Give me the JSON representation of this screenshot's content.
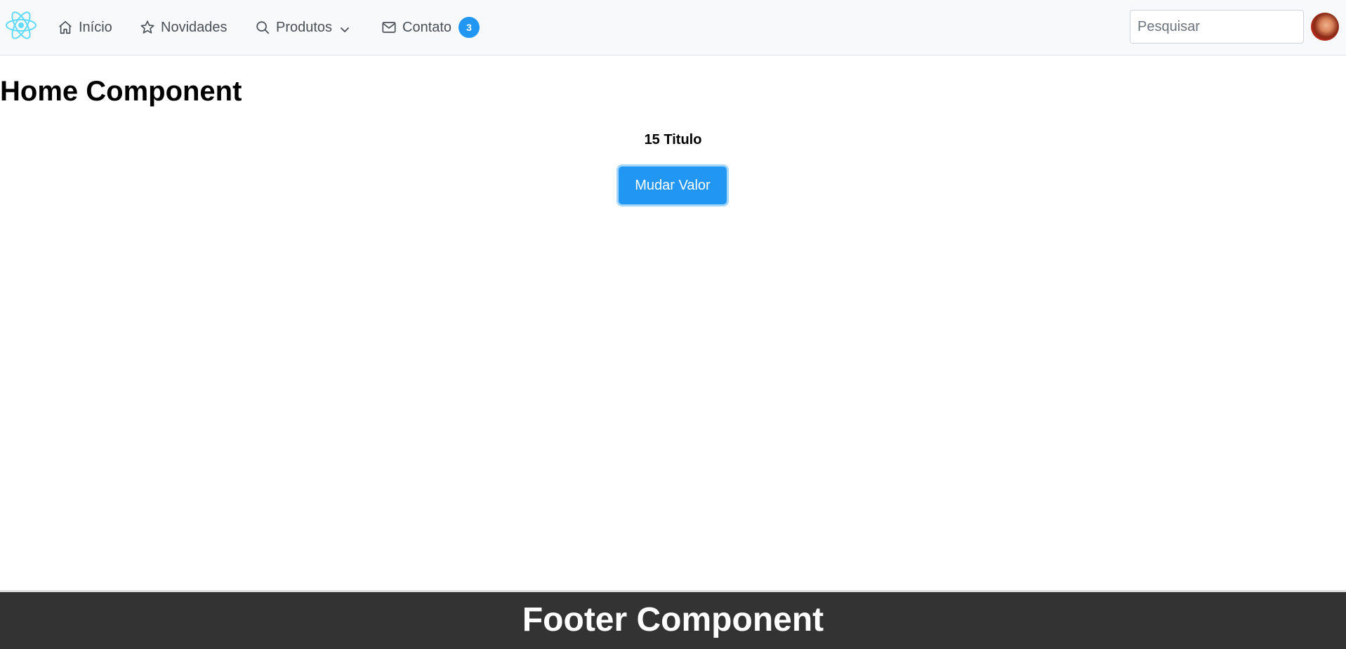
{
  "navbar": {
    "logo_icon": "react-logo-icon",
    "items": [
      {
        "label": "Início",
        "icon": "home-icon"
      },
      {
        "label": "Novidades",
        "icon": "star-icon"
      },
      {
        "label": "Produtos",
        "icon": "search-icon",
        "dropdown_icon": "chevron-down-icon"
      },
      {
        "label": "Contato",
        "icon": "envelope-icon",
        "badge": "3"
      }
    ],
    "search_placeholder": "Pesquisar",
    "avatar_icon": "user-avatar"
  },
  "main": {
    "title": "Home Component",
    "subtitle": "15 Titulo",
    "button_label": "Mudar Valor"
  },
  "footer": {
    "title": "Footer Component"
  },
  "colors": {
    "accent": "#2196f3",
    "navbar_bg": "#f8f9fa",
    "footer_bg": "#333333"
  }
}
